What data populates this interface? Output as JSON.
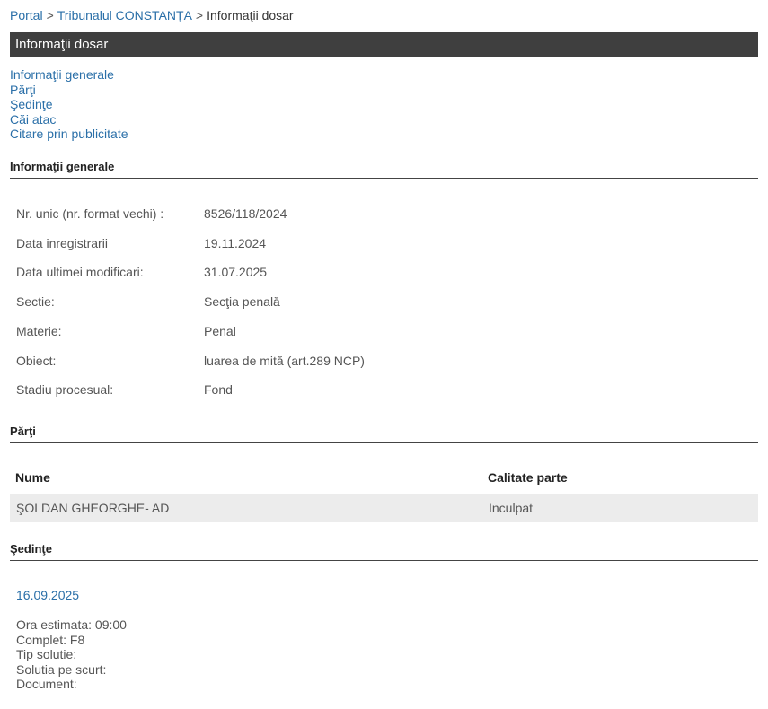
{
  "breadcrumb": {
    "items": [
      "Portal",
      "Tribunalul CONSTANŢA"
    ],
    "current": "Informaţii dosar",
    "separator": ">"
  },
  "page_title": "Informaţii dosar",
  "toc": [
    "Informaţii generale",
    "Părţi",
    "Şedinţe",
    "Căi atac",
    "Citare prin publicitate"
  ],
  "sections": {
    "general": "Informaţii generale",
    "parti": "Părţi",
    "sedinte": "Şedinţe"
  },
  "general_info": [
    {
      "label": "Nr. unic (nr. format vechi) :",
      "value": "8526/118/2024"
    },
    {
      "label": "Data inregistrarii",
      "value": "19.11.2024"
    },
    {
      "label": "Data ultimei modificari:",
      "value": "31.07.2025"
    },
    {
      "label": "Sectie:",
      "value": "Secţia penală"
    },
    {
      "label": "Materie:",
      "value": "Penal"
    },
    {
      "label": "Obiect:",
      "value": "luarea de mită (art.289 NCP)"
    },
    {
      "label": "Stadiu procesual:",
      "value": "Fond"
    }
  ],
  "parti": {
    "headers": [
      "Nume",
      "Calitate parte"
    ],
    "rows": [
      {
        "nume": "ŞOLDAN GHEORGHE- AD",
        "calitate": "Inculpat"
      }
    ]
  },
  "sedinte": {
    "date": "16.09.2025",
    "details": [
      "Ora estimata: 09:00",
      "Complet: F8",
      "Tip solutie:",
      "Solutia pe scurt:",
      "Document:"
    ]
  },
  "colors": {
    "link": "#2a6fa8",
    "title_bar_bg": "#3f3f3f",
    "row_bg": "#ececec"
  }
}
